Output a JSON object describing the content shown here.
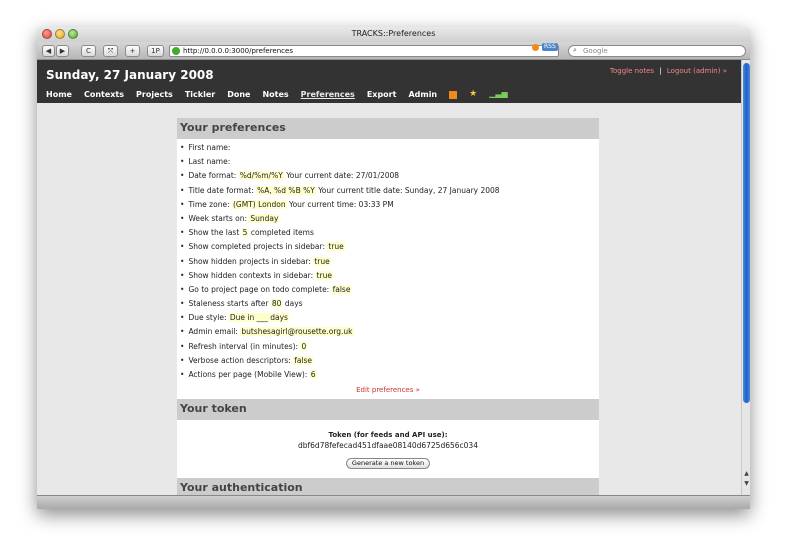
{
  "browser": {
    "window_title": "TRACKS::Preferences",
    "url": "http://0.0.0.0:3000/preferences",
    "rss_badge": "RSS",
    "search_placeholder": "Google",
    "buttons": {
      "back": "◀",
      "forward": "▶",
      "reload": "C",
      "snapback": "⤧",
      "add_bookmark": "+",
      "onepassword": "1P"
    }
  },
  "header": {
    "date": "Sunday, 27 January 2008",
    "toggle_notes": "Toggle notes",
    "separator": "|",
    "logout": "Logout (admin) »"
  },
  "nav": {
    "items": [
      "Home",
      "Contexts",
      "Projects",
      "Tickler",
      "Done",
      "Notes",
      "Preferences",
      "Export",
      "Admin"
    ],
    "active": "Preferences",
    "icons": [
      "rss-icon",
      "star-icon",
      "stats-icon"
    ]
  },
  "preferences": {
    "title": "Your preferences",
    "items": [
      {
        "label": "First name:",
        "value": "",
        "after": ""
      },
      {
        "label": "Last name:",
        "value": "",
        "after": ""
      },
      {
        "label": "Date format:",
        "value": "%d/%m/%Y",
        "after": "Your current date: 27/01/2008"
      },
      {
        "label": "Title date format:",
        "value": "%A, %d %B %Y",
        "after": "Your current title date: Sunday, 27 January 2008"
      },
      {
        "label": "Time zone:",
        "value": "(GMT) London",
        "after": "Your current time: 03:33 PM"
      },
      {
        "label": "Week starts on:",
        "value": "Sunday",
        "after": ""
      },
      {
        "label": "Show the last",
        "value": "5",
        "after": "completed items"
      },
      {
        "label": "Show completed projects in sidebar:",
        "value": "true",
        "after": ""
      },
      {
        "label": "Show hidden projects in sidebar:",
        "value": "true",
        "after": ""
      },
      {
        "label": "Show hidden contexts in sidebar:",
        "value": "true",
        "after": ""
      },
      {
        "label": "Go to project page on todo complete:",
        "value": "false",
        "after": ""
      },
      {
        "label": "Staleness starts after",
        "value": "80",
        "after": "days"
      },
      {
        "label": "Due style:",
        "value": "Due in ___ days",
        "after": ""
      },
      {
        "label": "Admin email:",
        "value": "butshesagirl@rousette.org.uk",
        "after": ""
      },
      {
        "label": "Refresh interval (in minutes):",
        "value": "0",
        "after": ""
      },
      {
        "label": "Verbose action descriptors:",
        "value": "false",
        "after": ""
      },
      {
        "label": "Actions per page (Mobile View):",
        "value": "6",
        "after": ""
      }
    ],
    "edit_link": "Edit preferences »"
  },
  "token": {
    "title": "Your token",
    "label": "Token (for feeds and API use):",
    "value": "dbf6d78fefecad451dfaae08140d6725d656c034",
    "button": "Generate a new token"
  },
  "authentication": {
    "title": "Your authentication"
  },
  "colors": {
    "header_bg": "#333333",
    "link_red": "#cc3333",
    "highlight": "#ffffcc",
    "panel_head": "#cccccc"
  }
}
